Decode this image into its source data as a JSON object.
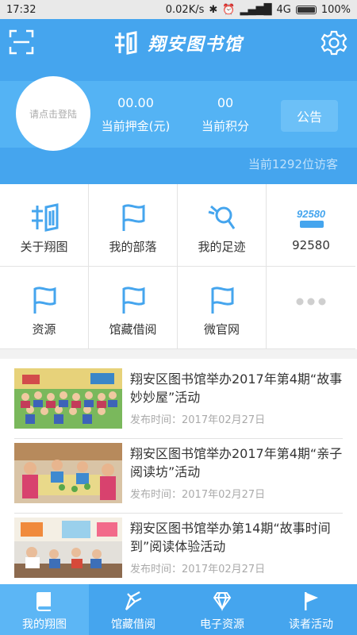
{
  "status_bar": {
    "time": "17:32",
    "speed": "0.02K/s",
    "network": "4G",
    "battery": "100%"
  },
  "header": {
    "app_title": "翔安图书馆",
    "scan_icon": "scan-icon",
    "settings_icon": "gear-icon"
  },
  "account": {
    "login_prompt": "请点击登陆",
    "deposit_value": "00.00",
    "deposit_label": "当前押金(元)",
    "points_value": "00",
    "points_label": "当前积分",
    "notice_label": "公告",
    "visitors": "当前1292位访客"
  },
  "menu": [
    {
      "label": "关于翔图",
      "icon": "xiangtu-logo-icon"
    },
    {
      "label": "我的部落",
      "icon": "flag-icon"
    },
    {
      "label": "我的足迹",
      "icon": "footprint-icon"
    },
    {
      "label": "92580",
      "icon": "92580-logo-icon"
    },
    {
      "label": "资源",
      "icon": "flag-icon"
    },
    {
      "label": "馆藏借阅",
      "icon": "flag-icon"
    },
    {
      "label": "微官网",
      "icon": "flag-icon"
    },
    {
      "label": "",
      "icon": "more-dots-icon"
    }
  ],
  "news": [
    {
      "title": "翔安区图书馆举办2017年第4期“故事妙妙屋”活动",
      "date": "发布时间：2017年02月27日"
    },
    {
      "title": "翔安区图书馆举办2017年第4期“亲子阅读坊”活动",
      "date": "发布时间：2017年02月27日"
    },
    {
      "title": "翔安区图书馆举办第14期“故事时间到”阅读体验活动",
      "date": "发布时间：2017年02月27日"
    }
  ],
  "tabs": [
    {
      "label": "我的翔图",
      "icon": "book-icon",
      "active": true
    },
    {
      "label": "馆藏借阅",
      "icon": "pen-icon",
      "active": false
    },
    {
      "label": "电子资源",
      "icon": "diamond-icon",
      "active": false
    },
    {
      "label": "读者活动",
      "icon": "flag-icon",
      "active": false
    }
  ],
  "colors": {
    "primary": "#45a5ee",
    "band": "#54b3f4",
    "text": "#333333",
    "muted": "#aaaaaa"
  }
}
